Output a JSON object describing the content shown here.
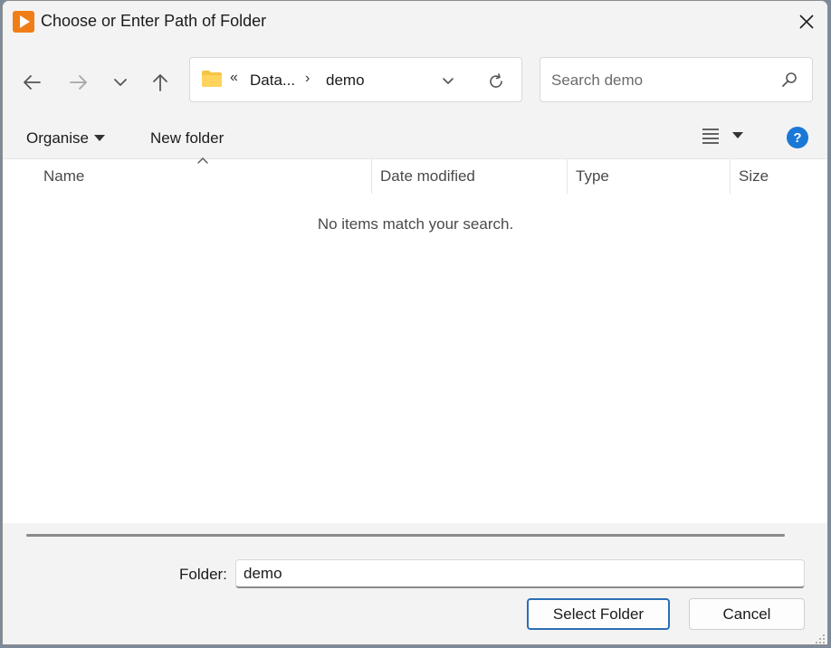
{
  "window": {
    "title": "Choose or Enter Path of Folder",
    "close_label": "✕"
  },
  "navigation": {
    "back_icon": "back-arrow-icon",
    "forward_icon": "forward-arrow-icon",
    "recent_icon": "chevron-down-icon",
    "up_icon": "up-arrow-icon"
  },
  "address": {
    "overflow": "«",
    "crumbs": [
      "Data...",
      "demo"
    ],
    "separator": "›"
  },
  "search": {
    "placeholder": "Search demo"
  },
  "commands": {
    "organise": "Organise",
    "new_folder": "New folder",
    "help": "?"
  },
  "columns": [
    "Name",
    "Date modified",
    "Type",
    "Size"
  ],
  "empty_message": "No items match your search.",
  "footer": {
    "folder_label": "Folder:",
    "folder_value": "demo",
    "select_button": "Select Folder",
    "cancel_button": "Cancel"
  },
  "colors": {
    "accent": "#2a6fb5",
    "help": "#1a78d6",
    "app_icon": "#f07d18"
  }
}
